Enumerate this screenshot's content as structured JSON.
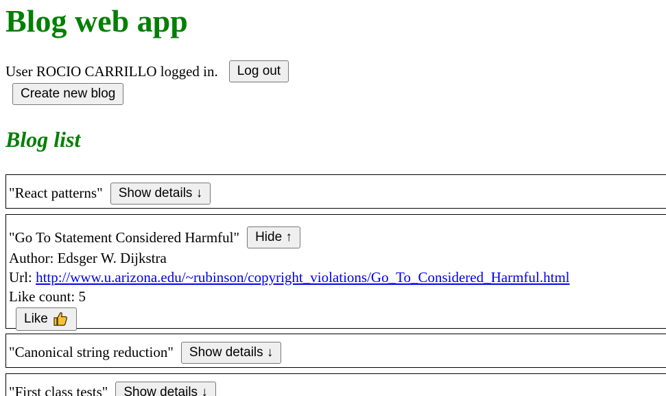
{
  "colors": {
    "heading": "#008000",
    "link": "#0000ee",
    "button_bg": "#efefef",
    "button_border": "#767676",
    "thumb": "#f6c136"
  },
  "header": {
    "title": "Blog web app"
  },
  "session": {
    "status_text": "User ROCIO CARRILLO logged in.",
    "logout_label": "Log out",
    "create_label": "Create new blog"
  },
  "list": {
    "title": "Blog list"
  },
  "blogs": [
    {
      "title": "\"React patterns\"",
      "toggle_label": "Show details ↓",
      "expanded": false
    },
    {
      "title": "\"Go To Statement Considered Harmful\"",
      "toggle_label": "Hide ↑",
      "expanded": true,
      "author_line": "Author: Edsger W. Dijkstra",
      "url_prefix": "Url: ",
      "url": "http://www.u.arizona.edu/~rubinson/copyright_violations/Go_To_Considered_Harmful.html",
      "likes_line": "Like count: 5",
      "like_label": "Like",
      "like_icon": "thumbs-up-icon"
    },
    {
      "title": "\"Canonical string reduction\"",
      "toggle_label": "Show details ↓",
      "expanded": false
    },
    {
      "title": "\"First class tests\"",
      "toggle_label": "Show details ↓",
      "expanded": false
    }
  ]
}
